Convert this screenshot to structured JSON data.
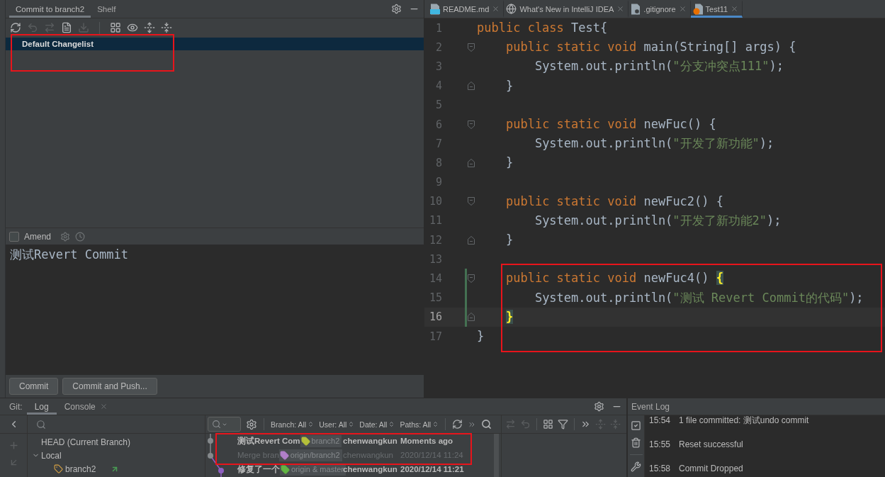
{
  "commit_panel": {
    "tabs": [
      {
        "label": "Commit to branch2",
        "selected": true
      },
      {
        "label": "Shelf",
        "selected": false
      }
    ],
    "toolbar": [
      [
        {
          "kind": "refresh",
          "disabled": false
        },
        {
          "kind": "undo",
          "disabled": true
        },
        {
          "kind": "move",
          "disabled": true
        },
        {
          "kind": "diff",
          "disabled": false
        },
        {
          "kind": "download",
          "disabled": true
        }
      ],
      [
        {
          "kind": "group",
          "disabled": false
        },
        {
          "kind": "eye",
          "disabled": false
        },
        {
          "kind": "expand",
          "disabled": false
        },
        {
          "kind": "collapse",
          "disabled": false
        }
      ]
    ],
    "framed_changelists": [
      {
        "name": "Default Changelist",
        "selected": true
      }
    ],
    "amend": {
      "label": "Amend",
      "checked": false
    },
    "message": "测试Revert Commit",
    "buttons": [
      "Commit",
      "Commit and Push..."
    ]
  },
  "editor": {
    "tabs": [
      {
        "label": "README.md",
        "kind": "markdown",
        "selected": false
      },
      {
        "label": "What's New in IntelliJ IDEA",
        "kind": "web",
        "selected": false
      },
      {
        "label": ".gitignore",
        "kind": "ignore",
        "selected": false
      },
      {
        "label": "Test11",
        "kind": "java",
        "selected": true
      }
    ],
    "lines": [
      {
        "number": "1",
        "kind": "plain",
        "tokens": [
          {
            "kind": "keyword",
            "text": "public class"
          },
          {
            "kind": "plain",
            "text": " Test{"
          }
        ],
        "current": false,
        "changed": false
      },
      {
        "number": "2",
        "kind": "open",
        "tokens": [
          {
            "kind": "keyword",
            "text": "    public static void"
          },
          {
            "kind": "plain",
            "text": " main(String[] args) {"
          }
        ],
        "current": false,
        "changed": false
      },
      {
        "number": "3",
        "kind": "plain",
        "tokens": [
          {
            "kind": "plain",
            "text": "        System.out.println("
          },
          {
            "kind": "string",
            "text": "\"分支冲突点111\""
          },
          {
            "kind": "plain",
            "text": ");"
          }
        ],
        "current": false,
        "changed": false
      },
      {
        "number": "4",
        "kind": "close",
        "tokens": [
          {
            "kind": "plain",
            "text": "    }"
          }
        ],
        "current": false,
        "changed": false
      },
      {
        "number": "5",
        "kind": "plain",
        "current": false,
        "changed": false
      },
      {
        "number": "6",
        "kind": "open",
        "tokens": [
          {
            "kind": "keyword",
            "text": "    public static void"
          },
          {
            "kind": "plain",
            "text": " newFuc() {"
          }
        ],
        "current": false,
        "changed": false
      },
      {
        "number": "7",
        "kind": "plain",
        "tokens": [
          {
            "kind": "plain",
            "text": "        System.out.println("
          },
          {
            "kind": "string",
            "text": "\"开发了新功能\""
          },
          {
            "kind": "plain",
            "text": ");"
          }
        ],
        "current": false,
        "changed": false
      },
      {
        "number": "8",
        "kind": "close",
        "tokens": [
          {
            "kind": "plain",
            "text": "    }"
          }
        ],
        "current": false,
        "changed": false
      },
      {
        "number": "9",
        "kind": "plain",
        "current": false,
        "changed": false
      },
      {
        "number": "10",
        "kind": "open",
        "tokens": [
          {
            "kind": "keyword",
            "text": "    public static void"
          },
          {
            "kind": "plain",
            "text": " newFuc2() {"
          }
        ],
        "current": false,
        "changed": false
      },
      {
        "number": "11",
        "kind": "plain",
        "tokens": [
          {
            "kind": "plain",
            "text": "        System.out.println("
          },
          {
            "kind": "string",
            "text": "\"开发了新功能2\""
          },
          {
            "kind": "plain",
            "text": ");"
          }
        ],
        "current": false,
        "changed": false
      },
      {
        "number": "12",
        "kind": "close",
        "tokens": [
          {
            "kind": "plain",
            "text": "    }"
          }
        ],
        "current": false,
        "changed": false
      },
      {
        "number": "13",
        "kind": "plain",
        "current": false,
        "changed": false
      }
    ],
    "framed_lines": [
      {
        "number": "14",
        "kind": "open",
        "tokens": [
          {
            "kind": "keyword",
            "text": "    public static void"
          },
          {
            "kind": "plain",
            "text": " newFuc4() "
          },
          {
            "kind": "brace_match",
            "text": "{"
          }
        ],
        "current": false,
        "changed": true
      },
      {
        "number": "15",
        "kind": "plain",
        "tokens": [
          {
            "kind": "plain",
            "text": "        System.out.println("
          },
          {
            "kind": "string",
            "text": "\"测试 Revert Commit的代码\""
          },
          {
            "kind": "plain",
            "text": ");"
          }
        ],
        "current": false,
        "changed": true
      },
      {
        "number": "16",
        "kind": "close",
        "tokens": [
          {
            "kind": "brace_match",
            "text": "    }"
          }
        ],
        "current": true,
        "changed": true
      },
      {
        "number": "17",
        "kind": "plain",
        "tokens": [
          {
            "kind": "plain",
            "text": "}"
          }
        ],
        "current": false,
        "changed": false
      }
    ]
  },
  "git_window": {
    "title": "Git:",
    "tabs": [
      {
        "label": "Log",
        "selected": true,
        "closable": false
      },
      {
        "label": "Console",
        "selected": false,
        "closable": true
      }
    ],
    "side_tools": [
      {
        "kind": "back",
        "disabled": false
      },
      {
        "kind": "add",
        "disabled": true
      },
      {
        "kind": "checkout",
        "disabled": true
      }
    ],
    "branches": [
      {
        "kind": "head",
        "label": "HEAD (Current Branch)"
      },
      {
        "kind": "group",
        "label": "Local",
        "expanded": true,
        "children": [
          {
            "kind": "branch",
            "label": "branch2"
          }
        ]
      }
    ],
    "filters": [
      "Branch: All",
      "User: All",
      "Date: All",
      "Paths: All"
    ],
    "framed_commits": [
      {
        "message": "测试Revert Com",
        "tag": {
          "label": "branch2",
          "color": "#b5c03a"
        },
        "author": "chenwangkun",
        "date": "Moments ago",
        "dimmed": false
      },
      {
        "message": "Merge bran",
        "tag": {
          "label": "origin/branch2",
          "color": "#b07fc8"
        },
        "author": "chenwangkun",
        "date": "2020/12/14 11:24",
        "dimmed": true
      }
    ],
    "commits": [
      {
        "message": "修复了一个",
        "tag": {
          "label": "origin & master",
          "color": "#62b543"
        },
        "author": "chenwangkun",
        "date": "2020/12/14 11:21",
        "dimmed": false
      }
    ],
    "details_toolbar": [
      [
        {
          "kind": "move",
          "disabled": true
        },
        {
          "kind": "undo",
          "disabled": true
        }
      ],
      [
        {
          "kind": "group",
          "disabled": false
        },
        {
          "kind": "filter",
          "disabled": false
        }
      ],
      [
        {
          "kind": "more",
          "disabled": false
        },
        {
          "kind": "expand",
          "disabled": true
        },
        {
          "kind": "collapse",
          "disabled": true
        }
      ]
    ]
  },
  "event_log": {
    "title": "Event Log",
    "entries": [
      {
        "time": "15:54",
        "text": "1 file committed: 测试undo commit"
      },
      {
        "time": "15:55",
        "text": "Reset successful"
      },
      {
        "time": "15:58",
        "text": "Commit Dropped"
      }
    ]
  }
}
